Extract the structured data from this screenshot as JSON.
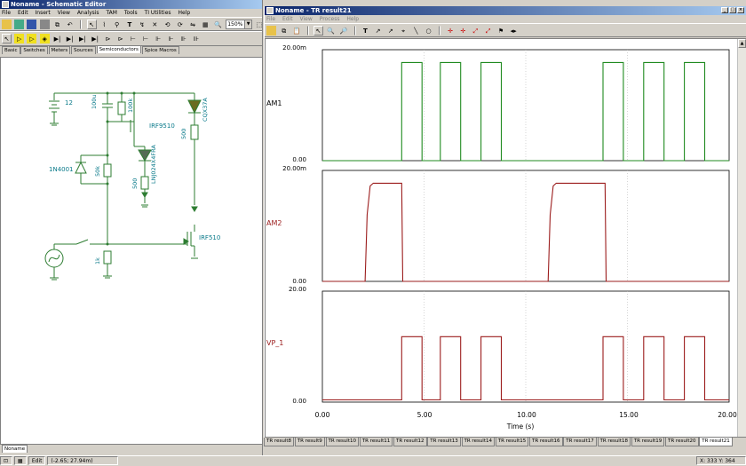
{
  "schematic": {
    "title": "Noname - Schematic Editor",
    "menu": [
      "File",
      "Edit",
      "Insert",
      "View",
      "Analysis",
      "TAM",
      "Tools",
      "TI Utilities",
      "Help"
    ],
    "zoom": "150%",
    "tabs": [
      "Basic",
      "Switches",
      "Meters",
      "Sources",
      "Semiconductors",
      "Spice Macros"
    ],
    "active_tab": "Semiconductors",
    "component_labels": {
      "battery": "12",
      "cap": "100u",
      "r100k": "100k",
      "q1": "IRF9510",
      "led1": "CQX37A",
      "r500a": "500",
      "led2": "LNJ024X4FRA",
      "r500b": "500",
      "d1": "1N4001",
      "r50k": "50k",
      "q2": "IRF510",
      "r1k": "1k"
    },
    "doc_tab": "Noname"
  },
  "results": {
    "title": "Noname - TR result21",
    "menu": [
      "File",
      "Edit",
      "View",
      "Process",
      "Help"
    ],
    "plots": [
      {
        "name": "AM1",
        "ymax": "20.00m",
        "ymin": "0.00",
        "color": "#1f8a1f"
      },
      {
        "name": "AM2",
        "ymax": "20.00m",
        "ymin": "0.00",
        "color": "#9b1c1c"
      },
      {
        "name": "VP_1",
        "ymax": "20.00",
        "ymin": "0.00",
        "color": "#9b1c1c"
      }
    ],
    "x_ticks": [
      "0.00",
      "5.00",
      "10.00",
      "15.00",
      "20.00"
    ],
    "x_label": "Time (s)",
    "result_tabs": [
      "TR result8",
      "TR result9",
      "TR result10",
      "TR result11",
      "TR result12",
      "TR result13",
      "TR result14",
      "TR result15",
      "TR result16",
      "TR result17",
      "TR result18",
      "TR result19",
      "TR result20",
      "TR result21"
    ],
    "active_result_tab": "TR result21"
  },
  "status": {
    "mode": "Edit",
    "coords_left": "(-2.65; 27.94m)",
    "coords_right": "X: 333  Y: 364"
  },
  "chart_data": [
    {
      "type": "line",
      "title": "AM1",
      "x_range": [
        0,
        20
      ],
      "ylim": [
        0,
        0.02
      ],
      "x": [
        0,
        3.9,
        3.9,
        4.9,
        4.9,
        5.8,
        5.8,
        6.8,
        6.8,
        7.8,
        7.8,
        8.8,
        8.8,
        13.8,
        13.8,
        14.8,
        14.8,
        15.8,
        15.8,
        16.8,
        16.8,
        17.8,
        17.8,
        18.8,
        18.8,
        20
      ],
      "values": [
        0,
        0,
        0.0177,
        0.0177,
        0,
        0,
        0.0177,
        0.0177,
        0,
        0,
        0.0177,
        0.0177,
        0,
        0,
        0.0177,
        0.0177,
        0,
        0,
        0.0177,
        0.0177,
        0,
        0,
        0.0177,
        0.0177,
        0,
        0
      ]
    },
    {
      "type": "line",
      "title": "AM2",
      "x_range": [
        0,
        20
      ],
      "ylim": [
        0,
        0.02
      ],
      "x": [
        0,
        2.1,
        2.2,
        2.35,
        2.5,
        3.9,
        3.95,
        11.1,
        11.2,
        11.35,
        11.5,
        13.9,
        13.95,
        20
      ],
      "values": [
        0,
        0,
        0.012,
        0.0172,
        0.0177,
        0.0177,
        0,
        0,
        0.012,
        0.0172,
        0.0177,
        0.0177,
        0,
        0
      ]
    },
    {
      "type": "line",
      "title": "VP_1",
      "x_range": [
        0,
        20
      ],
      "ylim": [
        0,
        20
      ],
      "x": [
        0,
        3.9,
        3.9,
        4.9,
        4.9,
        5.8,
        5.8,
        6.8,
        6.8,
        7.8,
        7.8,
        8.8,
        8.8,
        13.8,
        13.8,
        14.8,
        14.8,
        15.8,
        15.8,
        16.8,
        16.8,
        17.8,
        17.8,
        18.8,
        18.8,
        20
      ],
      "values": [
        0.4,
        0.4,
        11.8,
        11.8,
        0.4,
        0.4,
        11.8,
        11.8,
        0.4,
        0.4,
        11.8,
        11.8,
        0.4,
        0.4,
        11.8,
        11.8,
        0.4,
        0.4,
        11.8,
        11.8,
        0.4,
        0.4,
        11.8,
        11.8,
        0.4,
        0.4
      ]
    }
  ]
}
